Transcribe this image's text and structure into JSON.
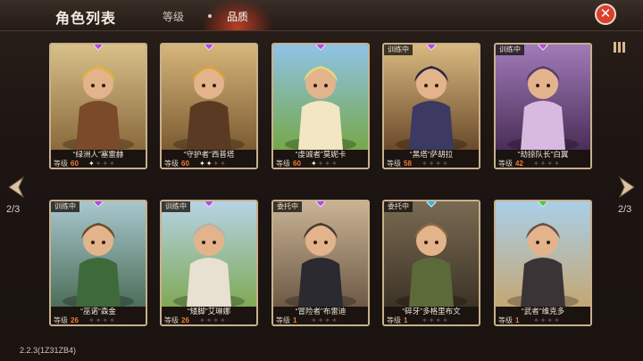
{
  "header": {
    "title": "角色列表",
    "tabs": [
      {
        "label": "等级",
        "active": false
      },
      {
        "label": "品质",
        "active": true
      }
    ],
    "close_icon": "close-x-icon"
  },
  "pagination": {
    "left": "2/3",
    "right": "2/3"
  },
  "level_label": "等级",
  "accent_color": "#f07a34",
  "cards": [
    {
      "name": "“绿洲人”塞雷赫",
      "level": "60",
      "stars": 1,
      "badge": "",
      "gem_color": "#b04ee0",
      "art": "pharaoh-warrior-shield"
    },
    {
      "name": "“守护者”西普塔",
      "level": "60",
      "stars": 2,
      "badge": "",
      "gem_color": "#b04ee0",
      "art": "anubis-guardian"
    },
    {
      "name": "“虔诚者”莫妮卡",
      "level": "60",
      "stars": 1,
      "badge": "",
      "gem_color": "#b04ee0",
      "art": "blonde-priestess"
    },
    {
      "name": "“黑塔”萨胡拉",
      "level": "58",
      "stars": 0,
      "badge": "训练中",
      "gem_color": "#b04ee0",
      "art": "hooded-fighter"
    },
    {
      "name": "“劫掠队长”白翼",
      "level": "42",
      "stars": 0,
      "badge": "训练中",
      "gem_color": "#b04ee0",
      "art": "winged-harpy"
    },
    {
      "name": "“巫诺”森金",
      "level": "26",
      "stars": 0,
      "badge": "训练中",
      "gem_color": "#b04ee0",
      "art": "green-orc-shaman"
    },
    {
      "name": "“矮脚”艾琳娜",
      "level": "26",
      "stars": 0,
      "badge": "训练中",
      "gem_color": "#b04ee0",
      "art": "silver-haired-mage"
    },
    {
      "name": "“冒险者”布雷迪",
      "level": "1",
      "stars": 0,
      "badge": "委托中",
      "gem_color": "#b04ee0",
      "art": "hooded-rogue"
    },
    {
      "name": "“碎牙”多格里布文",
      "level": "1",
      "stars": 0,
      "badge": "委托中",
      "gem_color": "#2fb8e0",
      "art": "crocodile-warrior"
    },
    {
      "name": "“武者”维克多",
      "level": "1",
      "stars": 0,
      "badge": "",
      "gem_color": "#3fd04a",
      "art": "masked-ninja"
    }
  ],
  "version": "2.2.3(1Z31ZB4)"
}
